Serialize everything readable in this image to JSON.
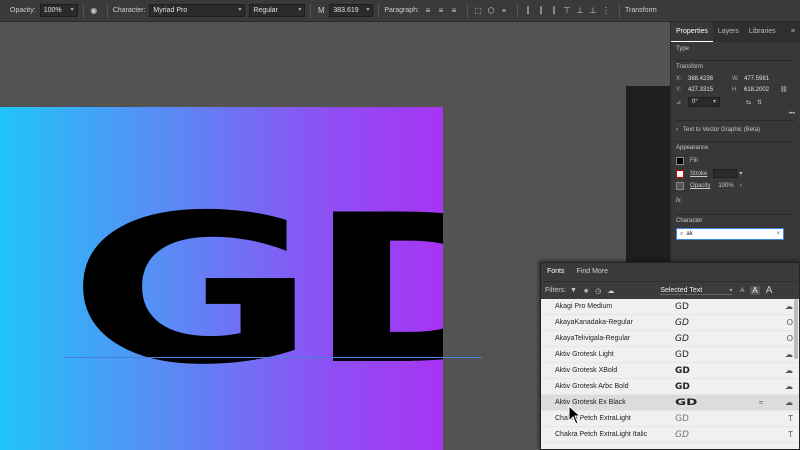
{
  "toolbar": {
    "opacity_label": "Opacity:",
    "opacity_value": "100%",
    "character_label": "Character:",
    "font_family": "Myriad Pro",
    "font_style": "Regular",
    "font_size": "383.619",
    "paragraph_label": "Paragraph:",
    "transform_label": "Transform"
  },
  "canvas": {
    "artwork_text": "GD"
  },
  "properties": {
    "tabs": [
      {
        "label": "Properties"
      },
      {
        "label": "Layers"
      },
      {
        "label": "Libraries"
      }
    ],
    "type_heading": "Type",
    "transform_heading": "Transform",
    "x_label": "X:",
    "x_value": "388.4236",
    "y_label": "Y:",
    "y_value": "427.3315",
    "w_label": "W:",
    "w_value": "477.5981",
    "h_label": "H:",
    "h_value": "618.2002",
    "rotate_value": "0°",
    "text_to_vector_label": "Text to Vector Graphic (Beta)",
    "appearance_heading": "Appearance",
    "fill_label": "Fill",
    "stroke_label": "Stroke",
    "opacity_label": "Opacity",
    "opacity_value": "100%",
    "fx_label": "fx.",
    "character_heading": "Character",
    "font_search_value": "ak"
  },
  "fonts_panel": {
    "tabs": [
      {
        "label": "Fonts"
      },
      {
        "label": "Find More"
      }
    ],
    "filters_label": "Filters:",
    "preview_mode": "Selected Text",
    "size_small_label": "A",
    "size_med_label": "A",
    "size_large_label": "A",
    "rows": [
      {
        "name": "Akagi Pro Medium",
        "sample": "GD"
      },
      {
        "name": "AkayaKanadaka-Regular",
        "sample": "GD"
      },
      {
        "name": "AkayaTelivigala-Regular",
        "sample": "GD"
      },
      {
        "name": "Aktiv Grotesk Light",
        "sample": "GD"
      },
      {
        "name": "Aktiv Grotesk XBold",
        "sample": "GD"
      },
      {
        "name": "Aktiv Grotesk Arbc Bold",
        "sample": "GD"
      },
      {
        "name": "Aktiv Grotesk Ex Black",
        "sample": "GD"
      },
      {
        "name": "Chakra Petch ExtraLight",
        "sample": "GD"
      },
      {
        "name": "Chakra Petch ExtraLight Italic",
        "sample": "GD"
      }
    ]
  }
}
